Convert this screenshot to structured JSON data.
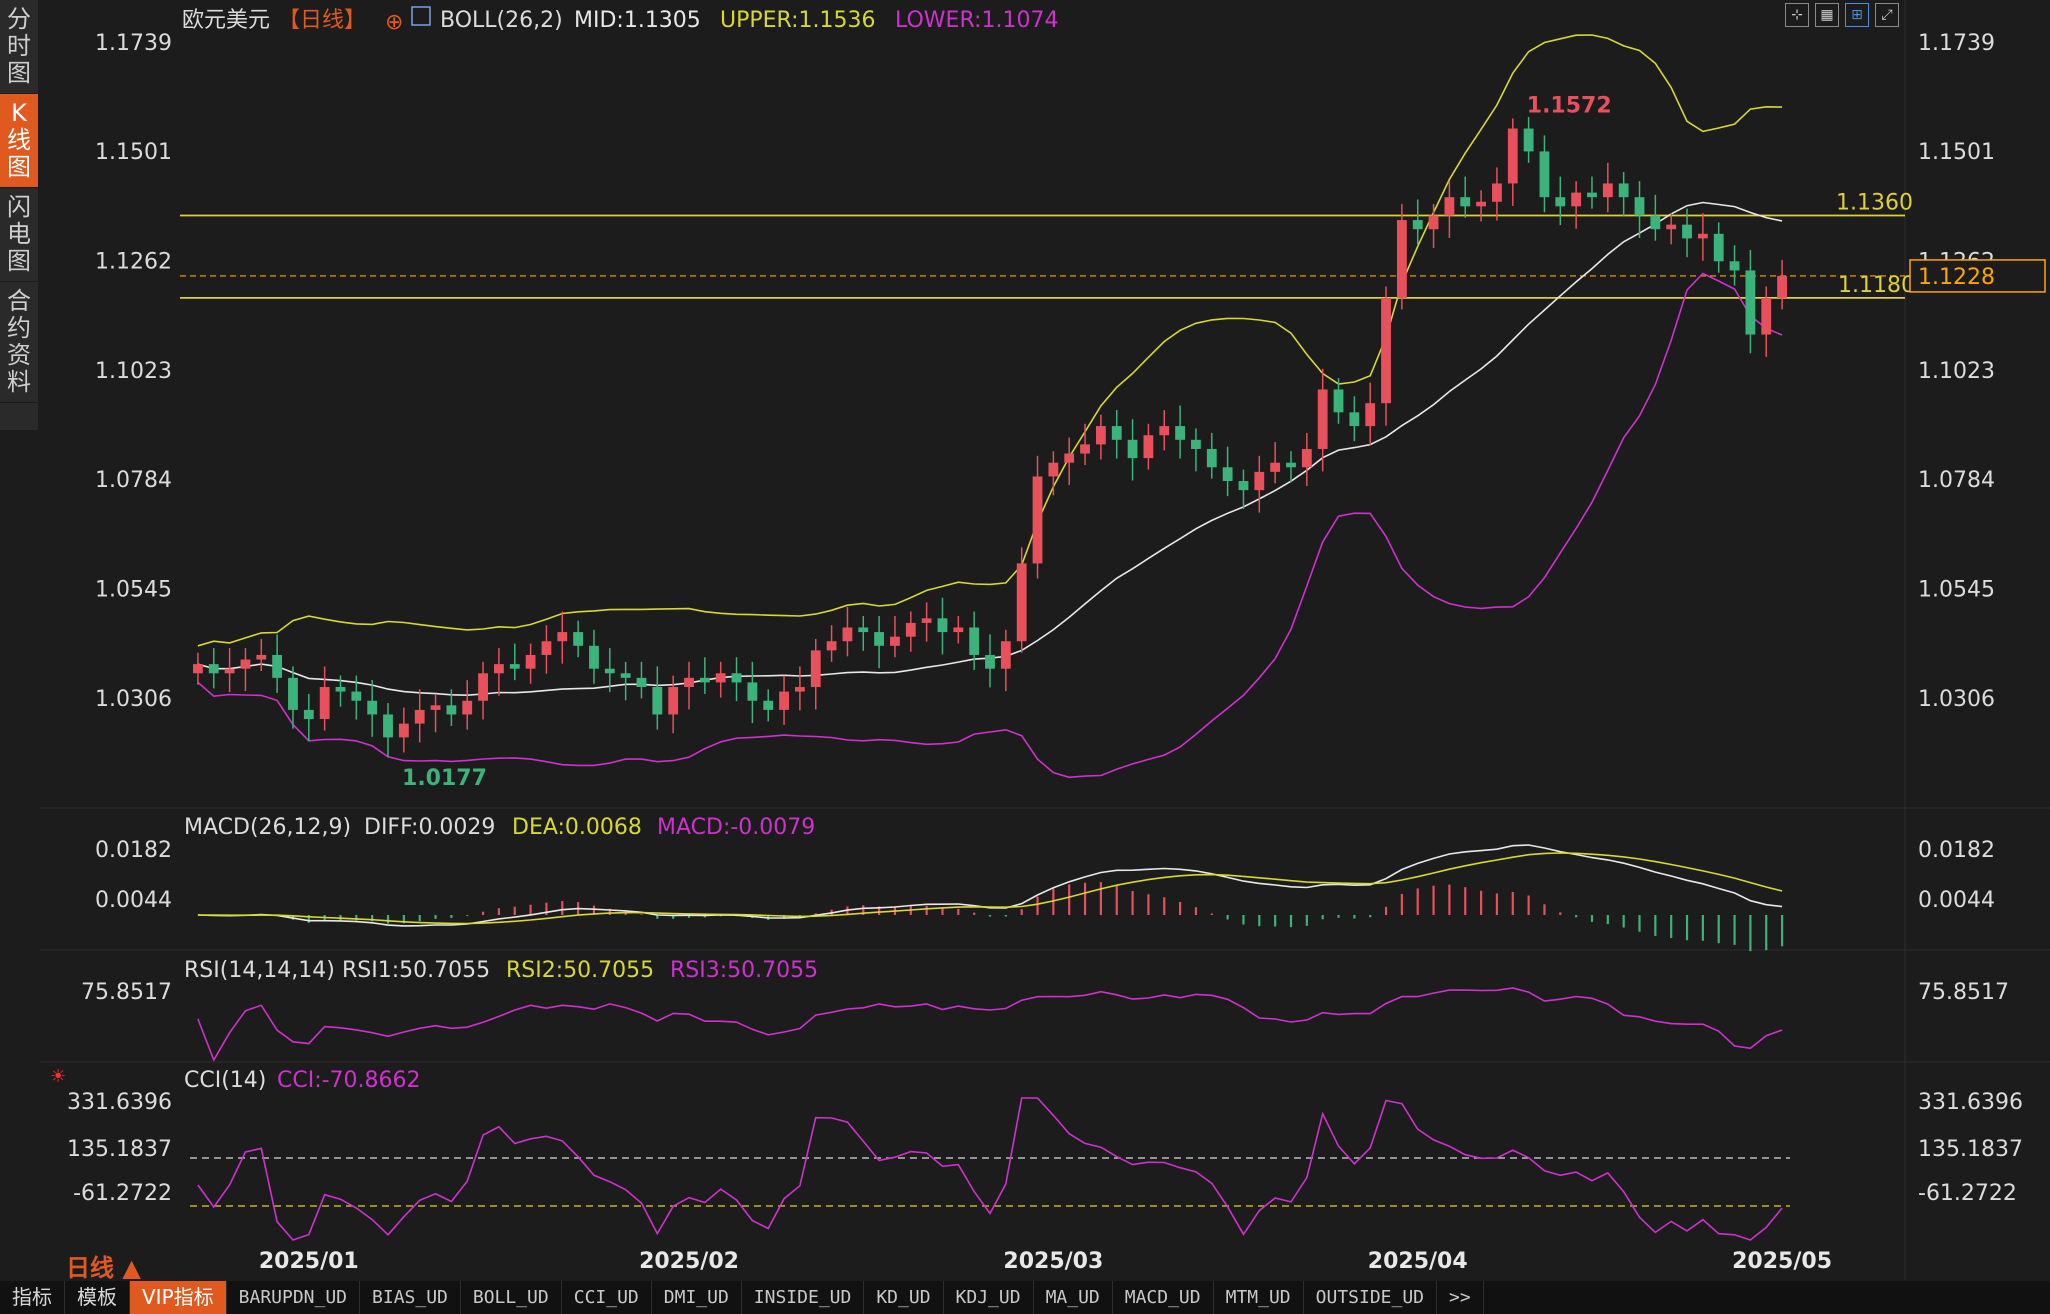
{
  "side_tabs": [
    {
      "label": "分时图",
      "chars": [
        "分",
        "时",
        "图"
      ],
      "active": false
    },
    {
      "label": "K线图",
      "chars": [
        "K",
        "线",
        "图"
      ],
      "active": true
    },
    {
      "label": "闪电图",
      "chars": [
        "闪",
        "电",
        "图"
      ],
      "active": false
    },
    {
      "label": "合约资料",
      "chars": [
        "合",
        "约",
        "资",
        "料"
      ],
      "active": false
    }
  ],
  "header": {
    "symbol": "欧元美元",
    "period": "【日线】",
    "add_icon": "plus-circle-icon",
    "indicator_icon": "chart-icon",
    "boll_label": "BOLL(26,2)",
    "mid": "MID:1.1305",
    "upper": "UPPER:1.1536",
    "lower": "LOWER:1.1074"
  },
  "toolbar_icons": [
    "crosshair-icon",
    "grid-icon",
    "boll-toggle-icon",
    "expand-icon"
  ],
  "price_axis": {
    "ticks": [
      "1.1739",
      "1.1501",
      "1.1262",
      "1.1023",
      "1.0784",
      "1.0545",
      "1.0306"
    ]
  },
  "annotations": {
    "high_label": "1.1572",
    "low_label": "1.0177",
    "resistance_label": "1.1360",
    "support_label": "1.1180",
    "last_price": "1.1228"
  },
  "macd": {
    "label": "MACD(26,12,9)",
    "diff": "DIFF:0.0029",
    "dea": "DEA:0.0068",
    "macd": "MACD:-0.0079",
    "ticks": [
      "0.0182",
      "0.0044"
    ]
  },
  "rsi": {
    "label": "RSI(14,14,14)",
    "rsi1": "RSI1:50.7055",
    "rsi2": "RSI2:50.7055",
    "rsi3": "RSI3:50.7055",
    "ticks": [
      "75.8517"
    ]
  },
  "cci": {
    "label": "CCI(14)",
    "cci": "CCI:-70.8662",
    "ticks": [
      "331.6396",
      "135.1837",
      "-61.2722"
    ]
  },
  "date_axis": [
    "2025/01",
    "2025/02",
    "2025/03",
    "2025/04",
    "2025/05"
  ],
  "period_selector": "日线 ▲",
  "bottom_tabs": [
    {
      "label": "指标",
      "style": "normal",
      "active": false
    },
    {
      "label": "模板",
      "style": "normal",
      "active": false
    },
    {
      "label": "VIP指标",
      "style": "normal",
      "active": true
    },
    {
      "label": "BARUPDN_UD",
      "style": "small",
      "active": false
    },
    {
      "label": "BIAS_UD",
      "style": "small",
      "active": false
    },
    {
      "label": "BOLL_UD",
      "style": "small",
      "active": false
    },
    {
      "label": "CCI_UD",
      "style": "small",
      "active": false
    },
    {
      "label": "DMI_UD",
      "style": "small",
      "active": false
    },
    {
      "label": "INSIDE_UD",
      "style": "small",
      "active": false
    },
    {
      "label": "KD_UD",
      "style": "small",
      "active": false
    },
    {
      "label": "KDJ_UD",
      "style": "small",
      "active": false
    },
    {
      "label": "MA_UD",
      "style": "small",
      "active": false
    },
    {
      "label": "MACD_UD",
      "style": "small",
      "active": false
    },
    {
      "label": "MTM_UD",
      "style": "small",
      "active": false
    },
    {
      "label": "OUTSIDE_UD",
      "style": "small",
      "active": false
    },
    {
      "label": ">>",
      "style": "small",
      "active": false
    }
  ],
  "colors": {
    "up": "#e8505b",
    "down": "#3cb37a",
    "mid_line": "#e8e8e8",
    "upper_line": "#d8d830",
    "lower_line": "#d030d0",
    "level_line": "#e0d030",
    "accent": "#e05a20",
    "price_box": "#ffa500"
  },
  "chart_data": {
    "type": "candlestick",
    "symbol": "欧元美元",
    "closes": [
      1.038,
      1.036,
      1.037,
      1.039,
      1.04,
      1.035,
      1.028,
      1.026,
      1.033,
      1.032,
      1.03,
      1.027,
      1.022,
      1.025,
      1.028,
      1.029,
      1.027,
      1.03,
      1.036,
      1.038,
      1.037,
      1.04,
      1.043,
      1.045,
      1.042,
      1.037,
      1.036,
      1.035,
      1.033,
      1.027,
      1.033,
      1.035,
      1.034,
      1.036,
      1.034,
      1.03,
      1.028,
      1.032,
      1.033,
      1.041,
      1.043,
      1.046,
      1.045,
      1.042,
      1.044,
      1.047,
      1.048,
      1.045,
      1.046,
      1.04,
      1.037,
      1.043,
      1.06,
      1.079,
      1.082,
      1.084,
      1.086,
      1.09,
      1.087,
      1.083,
      1.088,
      1.09,
      1.087,
      1.085,
      1.081,
      1.078,
      1.076,
      1.08,
      1.082,
      1.081,
      1.085,
      1.098,
      1.093,
      1.09,
      1.095,
      1.118,
      1.135,
      1.133,
      1.136,
      1.14,
      1.138,
      1.139,
      1.143,
      1.155,
      1.15,
      1.14,
      1.138,
      1.141,
      1.14,
      1.143,
      1.14,
      1.136,
      1.133,
      1.134,
      1.131,
      1.132,
      1.126,
      1.124,
      1.11,
      1.118,
      1.1228
    ],
    "high": 1.1572,
    "low": 1.0177,
    "levels": [
      1.136,
      1.118
    ],
    "last_price": 1.1228,
    "boll": {
      "mid": 1.1305,
      "upper": 1.1536,
      "lower": 1.1074
    },
    "macd": {
      "diff": 0.0029,
      "dea": 0.0068,
      "macd": -0.0079
    },
    "rsi": {
      "rsi1": 50.7055,
      "rsi2": 50.7055,
      "rsi3": 50.7055
    },
    "cci": -70.8662,
    "x_labels": [
      "2025/01",
      "2025/02",
      "2025/03",
      "2025/04",
      "2025/05"
    ],
    "y_ticks": [
      1.1739,
      1.1501,
      1.1262,
      1.1023,
      1.0784,
      1.0545,
      1.0306
    ]
  }
}
